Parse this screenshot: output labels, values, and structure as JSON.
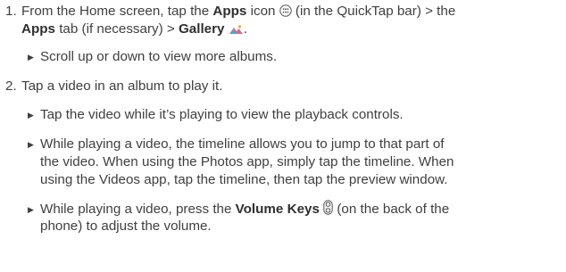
{
  "steps": [
    {
      "number": "1.",
      "line1": {
        "t1": "From the Home screen, tap the ",
        "b1": "Apps",
        "t2": " icon ",
        "t3": " (in the QuickTap bar) > the"
      },
      "line2": {
        "b1": "Apps",
        "t1": " tab (if necessary) > ",
        "b2": "Gallery",
        "t2": "."
      },
      "bullets": [
        {
          "text": "Scroll up or down to view more albums."
        }
      ]
    },
    {
      "number": "2.",
      "line1": {
        "t1": "Tap a video in an album to play it."
      },
      "bullets": [
        {
          "text": "Tap the video while it’s playing to view the playback controls."
        },
        {
          "lines": [
            "While playing a video, the timeline allows you to jump to that part of",
            "the video. When using the Photos app, simply tap the timeline. When",
            "using the Videos app, tap the timeline, then tap the preview window."
          ]
        },
        {
          "line1": {
            "t1": "While playing a video, press the ",
            "b1": "Volume Keys",
            "t2": " (on the back of the"
          },
          "line2": "phone) to adjust the volume."
        }
      ]
    }
  ],
  "icons": {
    "apps": "apps-grid-icon",
    "gallery": "gallery-icon",
    "volume": "volume-keys-icon",
    "bullet": "triangle-bullet-icon"
  },
  "colors": {
    "text": "#3f3f3f",
    "gallery_pink": "#e8637a",
    "gallery_blue": "#4aa3df"
  }
}
